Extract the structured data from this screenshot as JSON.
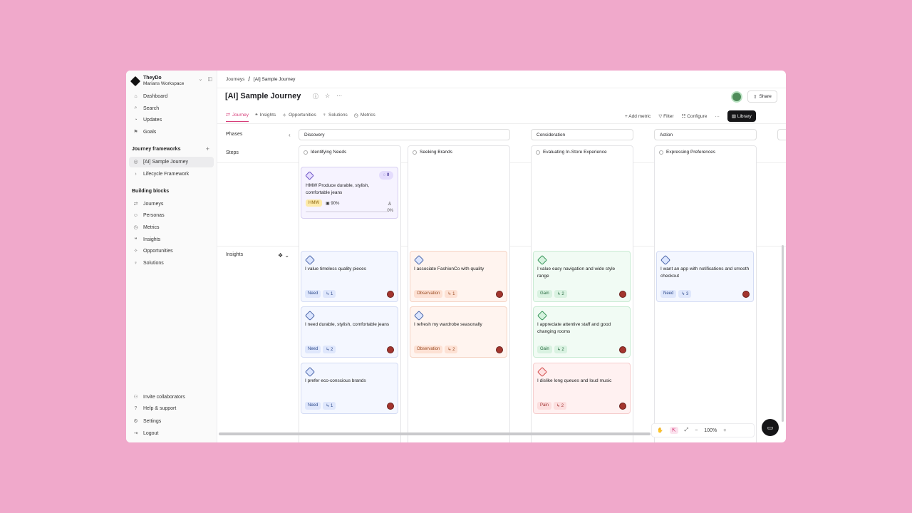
{
  "workspace": {
    "name": "TheyDo",
    "sub": "Marians Workspace"
  },
  "sidebar": {
    "nav": [
      {
        "icon": "⌂",
        "label": "Dashboard"
      },
      {
        "icon": "⌕",
        "label": "Search"
      },
      {
        "icon": "◔",
        "label": "Updates"
      },
      {
        "icon": "⚑",
        "label": "Goals"
      }
    ],
    "frameworks_heading": "Journey frameworks",
    "frameworks": [
      {
        "icon": "◎",
        "label": "[AI] Sample Journey"
      },
      {
        "icon": "›",
        "label": "Lifecycle Framework"
      }
    ],
    "building_heading": "Building blocks",
    "building": [
      {
        "icon": "⇄",
        "label": "Journeys"
      },
      {
        "icon": "☺",
        "label": "Personas"
      },
      {
        "icon": "◷",
        "label": "Metrics"
      },
      {
        "icon": "❝",
        "label": "Insights"
      },
      {
        "icon": "✧",
        "label": "Opportunities"
      },
      {
        "icon": "♀",
        "label": "Solutions"
      }
    ],
    "footer": [
      {
        "icon": "⚇",
        "label": "Invite collaborators"
      },
      {
        "icon": "?",
        "label": "Help & support"
      },
      {
        "icon": "⚙",
        "label": "Settings"
      },
      {
        "icon": "⇥",
        "label": "Logout"
      }
    ]
  },
  "breadcrumb": {
    "root": "Journeys",
    "sep": "/",
    "current": "[AI] Sample Journey"
  },
  "title": "[AI] Sample Journey",
  "share_label": "Share",
  "tabs": [
    {
      "icon": "⇄",
      "label": "Journey"
    },
    {
      "icon": "❝",
      "label": "Insights"
    },
    {
      "icon": "✧",
      "label": "Opportunities"
    },
    {
      "icon": "♀",
      "label": "Solutions"
    },
    {
      "icon": "◷",
      "label": "Metrics"
    }
  ],
  "actions": {
    "add_metric": "+ Add metric",
    "filter": "Filter",
    "configure": "Configure",
    "more": "···",
    "library": "Library"
  },
  "rows": {
    "phases": "Phases",
    "steps": "Steps",
    "insights": "Insights"
  },
  "phases": [
    "Discovery",
    "Consideration",
    "Action"
  ],
  "steps": [
    "Identifying Needs",
    "Seeking Brands",
    "Evaluating In-Store Experience",
    "Expressing Preferences"
  ],
  "hmw_card": {
    "count": "0",
    "text": "HMW Produce durable, stylish, comfortable jeans",
    "tag": "HMW",
    "confidence": "90%",
    "progress": "0%",
    "progress_value": 0
  },
  "insights": [
    {
      "type": "need",
      "text": "I value timeless quality pieces",
      "badge": "Need",
      "count": "1"
    },
    {
      "type": "need",
      "text": "I need durable, stylish, comfortable jeans",
      "badge": "Need",
      "count": "2"
    },
    {
      "type": "need",
      "text": "I prefer eco-conscious brands",
      "badge": "Need",
      "count": "1"
    },
    {
      "type": "obs",
      "text": "I associate FashionCo with quality",
      "badge": "Observation",
      "count": "1"
    },
    {
      "type": "obs",
      "text": "I refresh my wardrobe seasonally",
      "badge": "Observation",
      "count": "2"
    },
    {
      "type": "gain",
      "text": "I value easy navigation and wide style range",
      "badge": "Gain",
      "count": "2"
    },
    {
      "type": "gain",
      "text": "I appreciate attentive staff and good changing rooms",
      "badge": "Gain",
      "count": "2"
    },
    {
      "type": "pain",
      "text": "I dislike long queues and loud music",
      "badge": "Pain",
      "count": "2"
    },
    {
      "type": "need",
      "text": "I want an app with notifications and smooth checkout",
      "badge": "Need",
      "count": "3"
    }
  ],
  "zoom": "100%",
  "colors": {
    "accent": "#d63d79",
    "background": "#f0a9cb"
  }
}
